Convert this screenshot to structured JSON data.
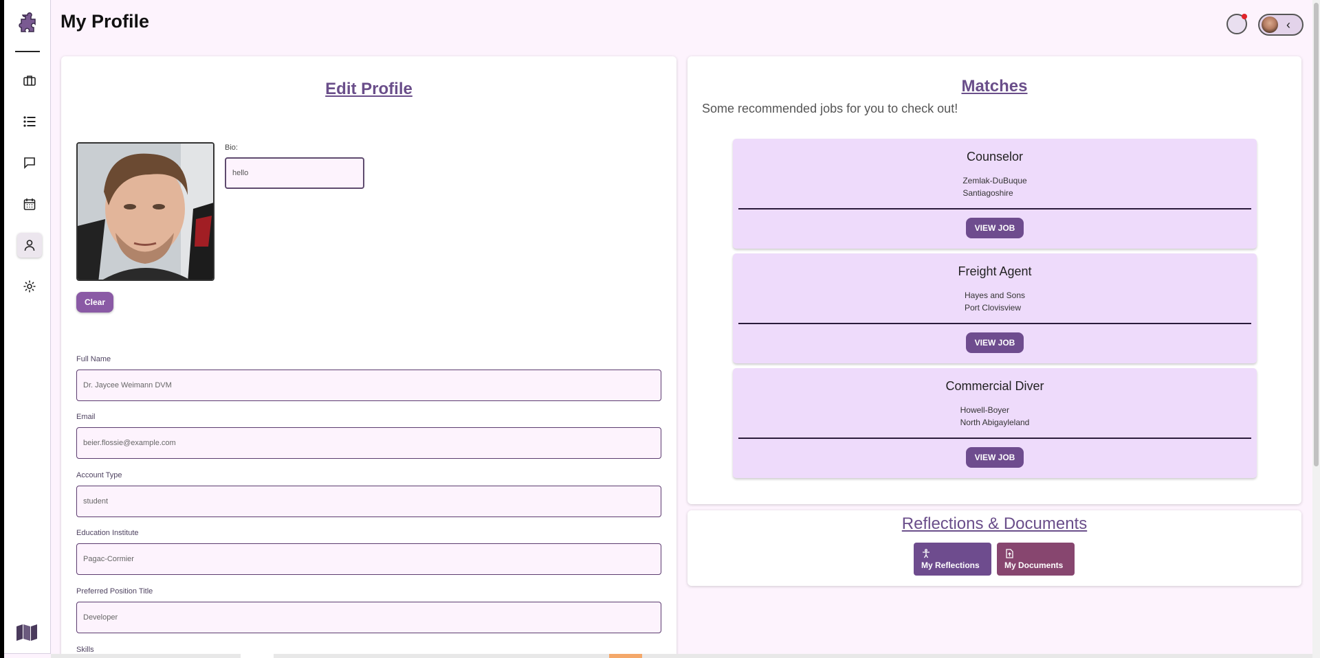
{
  "page": {
    "title": "My Profile"
  },
  "sidebar": {
    "items": [
      {
        "icon": "briefcase-icon"
      },
      {
        "icon": "list-icon"
      },
      {
        "icon": "chat-icon"
      },
      {
        "icon": "calendar-icon"
      },
      {
        "icon": "person-icon",
        "active": true
      },
      {
        "icon": "gear-icon"
      }
    ]
  },
  "edit_profile": {
    "title": "Edit Profile",
    "bio_label": "Bio:",
    "bio_value": "hello",
    "clear_label": "Clear",
    "fields": [
      {
        "label": "Full Name",
        "value": "Dr. Jaycee Weimann DVM"
      },
      {
        "label": "Email",
        "value": "beier.flossie@example.com"
      },
      {
        "label": "Account Type",
        "value": "student"
      },
      {
        "label": "Education Institute",
        "value": "Pagac-Cormier"
      },
      {
        "label": "Preferred Position Title",
        "value": "Developer"
      },
      {
        "label": "Skills"
      }
    ]
  },
  "matches": {
    "title": "Matches",
    "subtitle": "Some recommended jobs for you to check out!",
    "jobs": [
      {
        "title": "Counselor",
        "company": "Zemlak-DuBuque",
        "location": "Santiagoshire",
        "button": "VIEW JOB"
      },
      {
        "title": "Freight Agent",
        "company": "Hayes and Sons",
        "location": "Port Clovisview",
        "button": "VIEW JOB"
      },
      {
        "title": "Commercial Diver",
        "company": "Howell-Boyer",
        "location": "North Abigayleland",
        "button": "VIEW JOB"
      }
    ]
  },
  "reflections": {
    "title": "Reflections & Documents",
    "reflections_button": "My Reflections",
    "documents_button": "My Documents"
  },
  "colors": {
    "accent": "#6e4c8e",
    "background": "#fdf3fd",
    "job_card": "#eedbfb",
    "documents_button": "#87466f"
  }
}
